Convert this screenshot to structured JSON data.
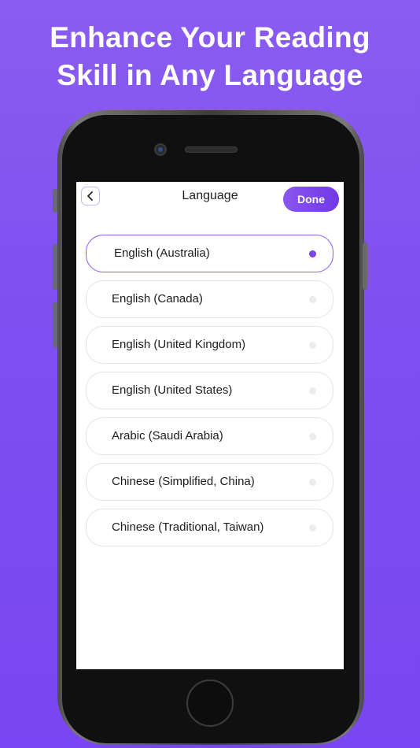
{
  "headline": {
    "line1": "Enhance Your Reading",
    "line2": "Skill in Any Language"
  },
  "nav": {
    "title": "Language",
    "done_label": "Done",
    "back_icon": "chevron-left-icon"
  },
  "languages": [
    {
      "label": "English (Australia)",
      "selected": true
    },
    {
      "label": "English (Canada)",
      "selected": false
    },
    {
      "label": "English (United Kingdom)",
      "selected": false
    },
    {
      "label": "English (United States)",
      "selected": false
    },
    {
      "label": "Arabic (Saudi Arabia)",
      "selected": false
    },
    {
      "label": "Chinese (Simplified, China)",
      "selected": false
    },
    {
      "label": "Chinese (Traditional, Taiwan)",
      "selected": false
    }
  ],
  "colors": {
    "background": "#7d4ff0",
    "accent": "#7a44ea",
    "radio_unselected": "#ececec"
  }
}
